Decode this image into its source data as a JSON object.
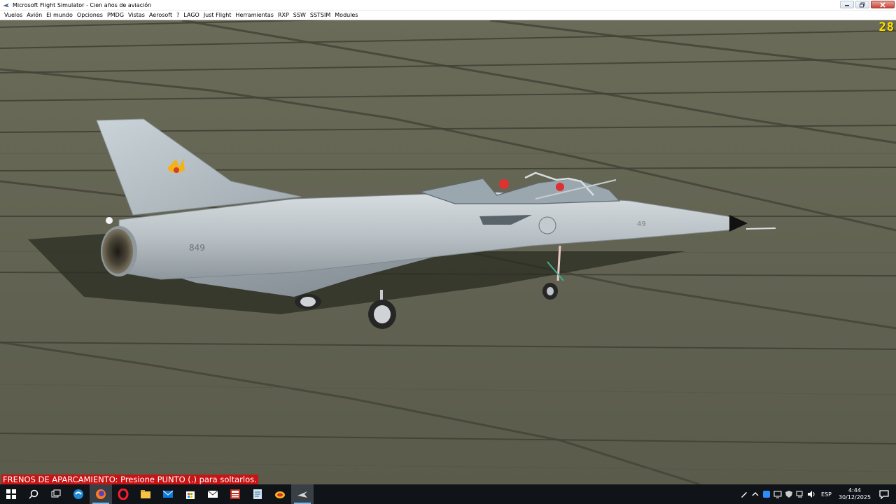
{
  "window": {
    "title": "Microsoft Flight Simulator - Cien años de aviación"
  },
  "menu": [
    "Vuelos",
    "Avión",
    "El mundo",
    "Opciones",
    "PMDG",
    "Vistas",
    "Aerosoft",
    "?",
    "LAGO",
    "Just Flight",
    "Herramientas",
    "RXP",
    "SSW",
    "SSTSIM",
    "Modules"
  ],
  "hud": {
    "frame_rate": "28",
    "status_message": "FRENOS DE APARCAMIENTO: Presione PUNTO (.) para soltarlos."
  },
  "aircraft": {
    "tail_number": "849",
    "nose_number": "49"
  },
  "taskbar": {
    "apps": [
      "start-icon",
      "search-icon",
      "task-view-icon",
      "edge-icon",
      "firefox-icon",
      "opera-icon",
      "file-explorer-icon",
      "mail-icon",
      "store-icon",
      "envelope-icon",
      "calculator-icon",
      "notes-icon",
      "browser-icon",
      "flight-simulator-icon"
    ],
    "active_app": "flight-simulator-icon",
    "language": "ESP",
    "time": "4:44",
    "date": "30/12/2025"
  },
  "colors": {
    "tarmac": "#5f604f",
    "fps_text": "#ffe000",
    "status_bg": "#c81414",
    "taskbar_bg": "#101418"
  }
}
